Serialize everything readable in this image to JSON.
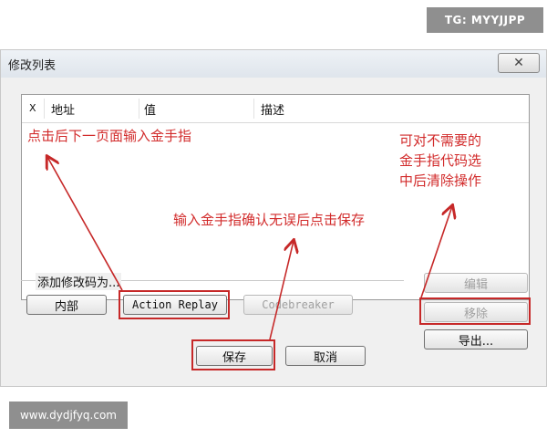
{
  "watermarks": {
    "top": "TG: MYYJJPP",
    "bottom": "www.dydjfyq.com"
  },
  "window": {
    "title": "修改列表",
    "close_glyph": "✕"
  },
  "list": {
    "columns": {
      "x": "X",
      "address": "地址",
      "value": "值",
      "description": "描述"
    }
  },
  "add_group": {
    "label": "添加修改码为...",
    "buttons": {
      "internal": "内部",
      "action_replay": "Action Replay",
      "codebreaker": "Codebreaker"
    }
  },
  "side_buttons": {
    "edit": "编辑",
    "remove": "移除",
    "export": "导出..."
  },
  "footer": {
    "save": "保存",
    "cancel": "取消"
  },
  "annotations": {
    "top_left": "点击后下一页面输入金手指",
    "right": [
      "可对不需要的",
      "金手指代码选",
      "中后清除操作"
    ],
    "center": "输入金手指确认无误后点击保存"
  },
  "colors": {
    "annotation": "#d22b2b",
    "highlight": "#c62828"
  }
}
